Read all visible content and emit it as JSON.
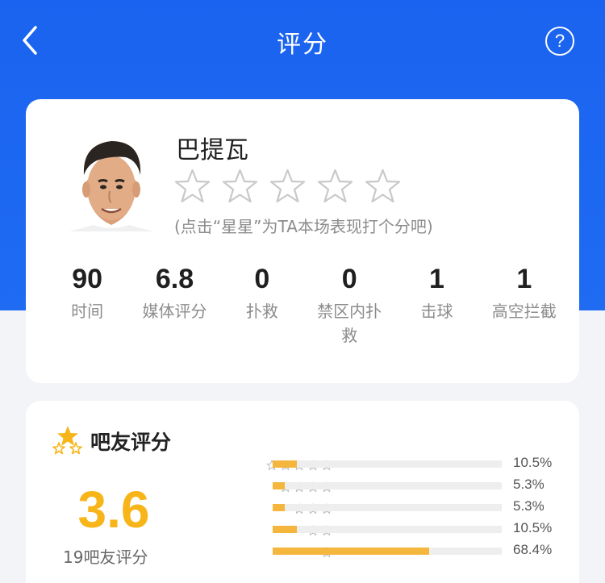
{
  "header": {
    "title": "评分",
    "back_icon": "chevron-left-icon",
    "help_label": "?",
    "background_color": "#1a63f0"
  },
  "player": {
    "name": "巴提瓦",
    "rating_stars": 5,
    "hint": "(点击“星星”为TA本场表现打个分吧)",
    "stats": [
      {
        "value": "90",
        "label": "时间"
      },
      {
        "value": "6.8",
        "label": "媒体评分"
      },
      {
        "value": "0",
        "label": "扑救"
      },
      {
        "value": "0",
        "label": "禁区内扑救"
      },
      {
        "value": "1",
        "label": "击球"
      },
      {
        "value": "1",
        "label": "高空拦截"
      }
    ]
  },
  "fan_rating": {
    "title": "吧友评分",
    "score": "3.6",
    "count_label": "19吧友评分",
    "accent_color": "#f7b519",
    "distribution": [
      {
        "stars": 5,
        "percent": 10.5,
        "label": "10.5%"
      },
      {
        "stars": 4,
        "percent": 5.3,
        "label": "5.3%"
      },
      {
        "stars": 3,
        "percent": 5.3,
        "label": "5.3%"
      },
      {
        "stars": 2,
        "percent": 10.5,
        "label": "10.5%"
      },
      {
        "stars": 1,
        "percent": 68.4,
        "label": "68.4%"
      }
    ]
  }
}
